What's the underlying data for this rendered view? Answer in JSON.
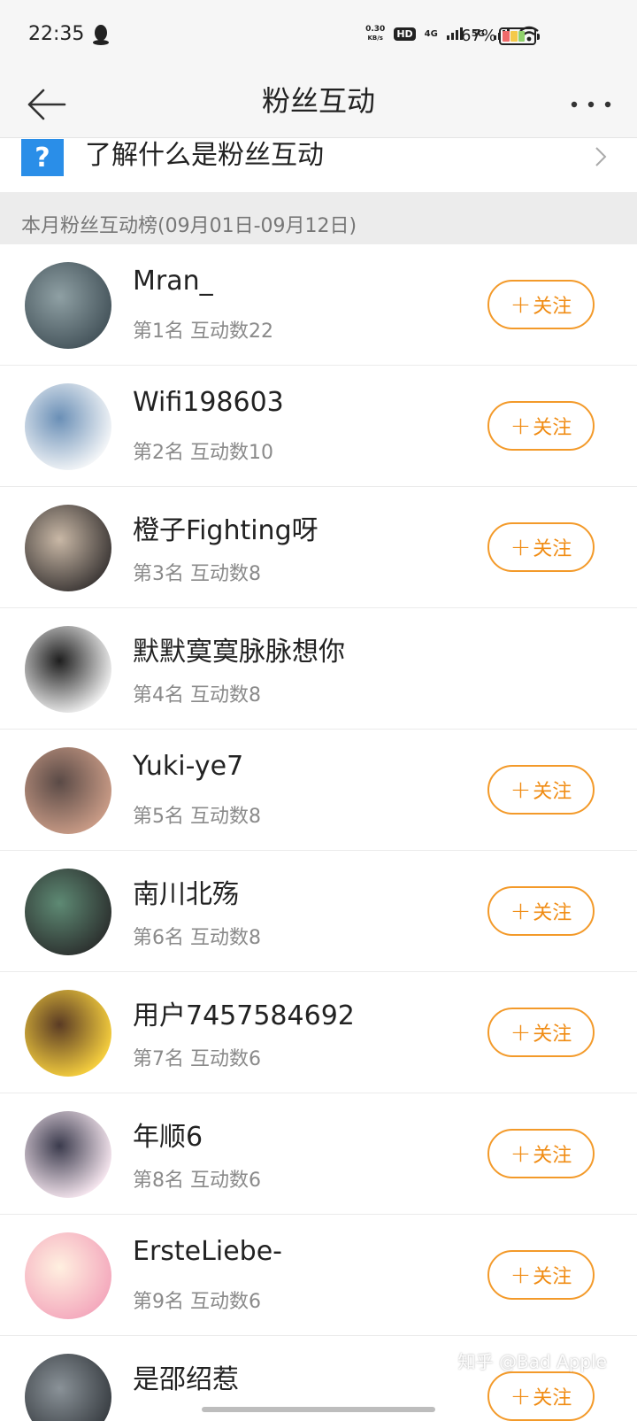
{
  "status_bar": {
    "time": "22:35",
    "net_speed": "0.30",
    "net_speed_unit": "KB/s",
    "hd": "HD",
    "net_4g": "4G",
    "net_5g": "5G",
    "battery": "67%"
  },
  "nav": {
    "title": "粉丝互动",
    "back_icon": "back-arrow-icon",
    "more_icon": "more-dots-icon"
  },
  "info_row": {
    "icon": "?",
    "text": "了解什么是粉丝互动"
  },
  "section": {
    "title": "本月粉丝互动榜(09月01日-09月12日)"
  },
  "follow_label": "关注",
  "fans": [
    {
      "name": "Mran_",
      "rank": "第1名",
      "count": "互动数22",
      "follow": true,
      "avatar_colors": [
        "#46555c",
        "#8fa0a4"
      ]
    },
    {
      "name": "Wifi198603",
      "rank": "第2名",
      "count": "互动数10",
      "follow": true,
      "avatar_colors": [
        "#f4f6f8",
        "#6a8fb6"
      ]
    },
    {
      "name": "橙子Fighting呀",
      "rank": "第3名",
      "count": "互动数8",
      "follow": true,
      "avatar_colors": [
        "#3f3a38",
        "#c9b8a6"
      ]
    },
    {
      "name": "默默寞寞脉脉想你",
      "rank": "第4名",
      "count": "互动数8",
      "follow": false,
      "avatar_colors": [
        "#efefef",
        "#1e1e1e"
      ]
    },
    {
      "name": "Yuki-ye7",
      "rank": "第5名",
      "count": "互动数8",
      "follow": true,
      "avatar_colors": [
        "#c99b86",
        "#5a4a46"
      ]
    },
    {
      "name": "南川北殇",
      "rank": "第6名",
      "count": "互动数8",
      "follow": true,
      "avatar_colors": [
        "#2d3230",
        "#5e8a74"
      ]
    },
    {
      "name": "用户7457584692",
      "rank": "第7名",
      "count": "互动数6",
      "follow": true,
      "avatar_colors": [
        "#f6cf3e",
        "#5a3b24"
      ]
    },
    {
      "name": "年顺6",
      "rank": "第8名",
      "count": "互动数6",
      "follow": true,
      "avatar_colors": [
        "#f6e6ef",
        "#3b3b4d"
      ]
    },
    {
      "name": "ErsteLiebe-",
      "rank": "第9名",
      "count": "互动数6",
      "follow": true,
      "avatar_colors": [
        "#f4a9bd",
        "#fff0e0"
      ]
    },
    {
      "name": "是邵绍惹",
      "rank": "",
      "count": "",
      "follow": true,
      "avatar_colors": [
        "#3a3f44",
        "#8a9298"
      ]
    }
  ],
  "watermark": "知乎 @Bad Apple",
  "colors": {
    "accent": "#f08c14",
    "question_icon_bg": "#2a8ee8"
  }
}
